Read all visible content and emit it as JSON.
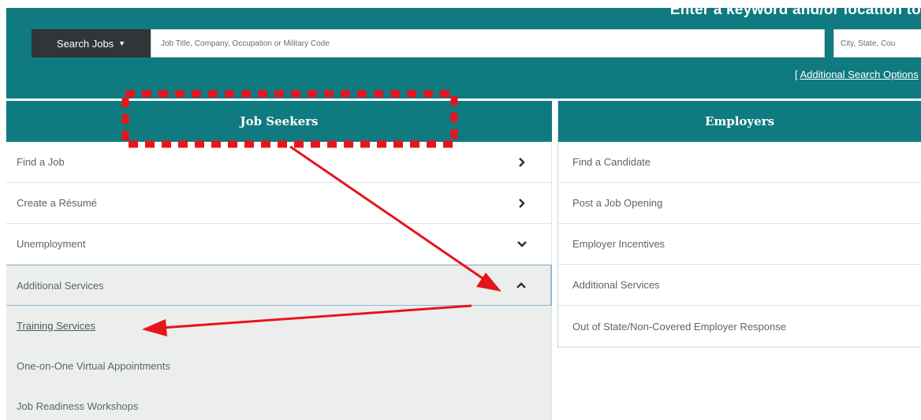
{
  "search": {
    "tagline": "Enter a keyword and/or location to",
    "type_label": "Search  Jobs",
    "keyword_placeholder": "Job Title, Company, Occupation or Military Code",
    "location_placeholder": "City, State, Cou",
    "advanced_options_open": "[ ",
    "advanced_options_label": "Additional Search Options",
    "advanced_options_close": " ]"
  },
  "job_seekers": {
    "header": "Job Seekers",
    "items": [
      {
        "label": "Find a Job",
        "chevron": "chevron-right-icon"
      },
      {
        "label": "Create a Résumé",
        "chevron": "chevron-right-icon"
      },
      {
        "label": "Unemployment",
        "chevron": "chevron-down-icon"
      },
      {
        "label": "Additional Services",
        "chevron": "chevron-up-icon"
      }
    ],
    "sub_items": [
      {
        "label": "Training Services"
      },
      {
        "label": "One-on-One Virtual Appointments"
      },
      {
        "label": "Job Readiness Workshops"
      }
    ]
  },
  "employers": {
    "header": "Employers",
    "items": [
      {
        "label": "Find a Candidate"
      },
      {
        "label": "Post a Job Opening"
      },
      {
        "label": "Employer Incentives"
      },
      {
        "label": "Additional Services"
      },
      {
        "label": "Out of State/Non-Covered Employer Response"
      }
    ]
  },
  "colors": {
    "brand_teal": "#0f7a80",
    "annotation_red": "#e8141b",
    "search_button_bg": "#2f3538",
    "expanded_panel_bg": "#eceeee"
  }
}
